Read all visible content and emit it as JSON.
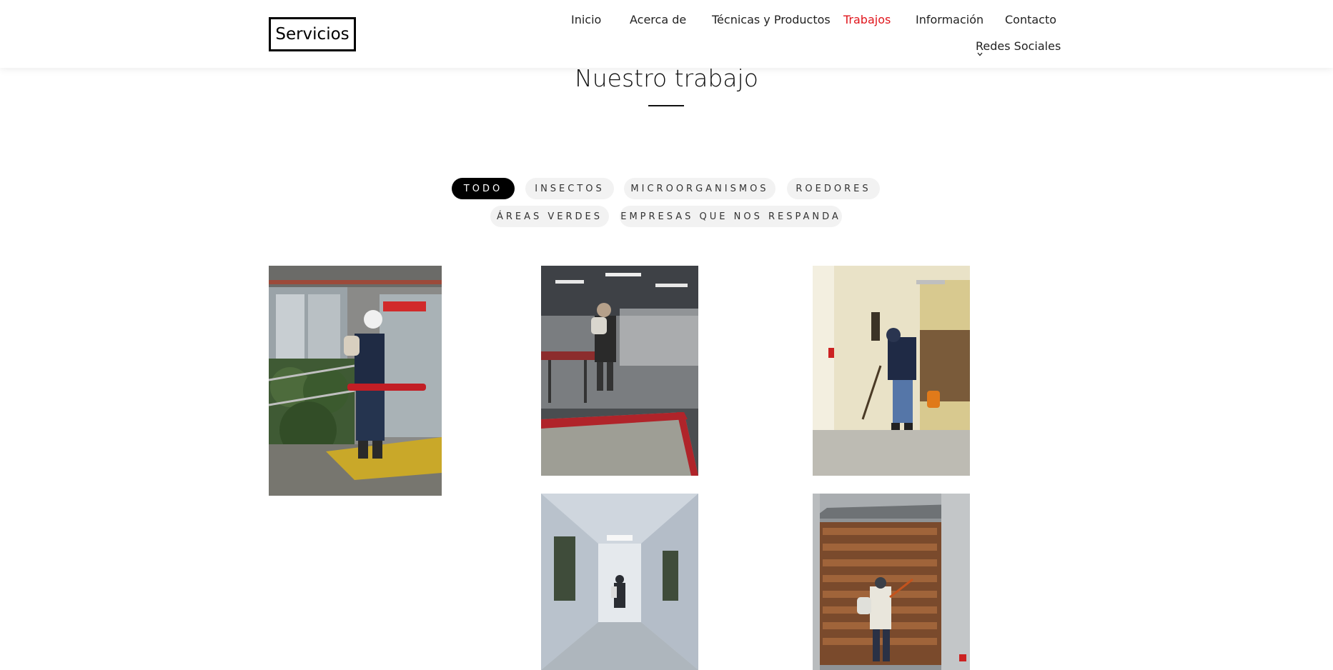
{
  "header": {
    "logo": "Servicios",
    "nav": [
      "Inicio",
      "Acerca de",
      "Técnicas y Productos",
      "Trabajos",
      "Información",
      "Contacto"
    ],
    "active_nav": "Trabajos",
    "social_label": "Redes Sociales"
  },
  "main": {
    "title": "Nuestro trabajo",
    "filters": [
      "TODO",
      "INSECTOS",
      "MICROORGANISMOS",
      "ROEDORES",
      "ÁREAS VERDES",
      "EMPRESAS QUE NOS RESPANDA"
    ],
    "active_filter": "TODO"
  },
  "colors": {
    "accent": "#e0141b",
    "filter_active_bg": "#000000",
    "filter_bg": "#f2f2f2"
  }
}
